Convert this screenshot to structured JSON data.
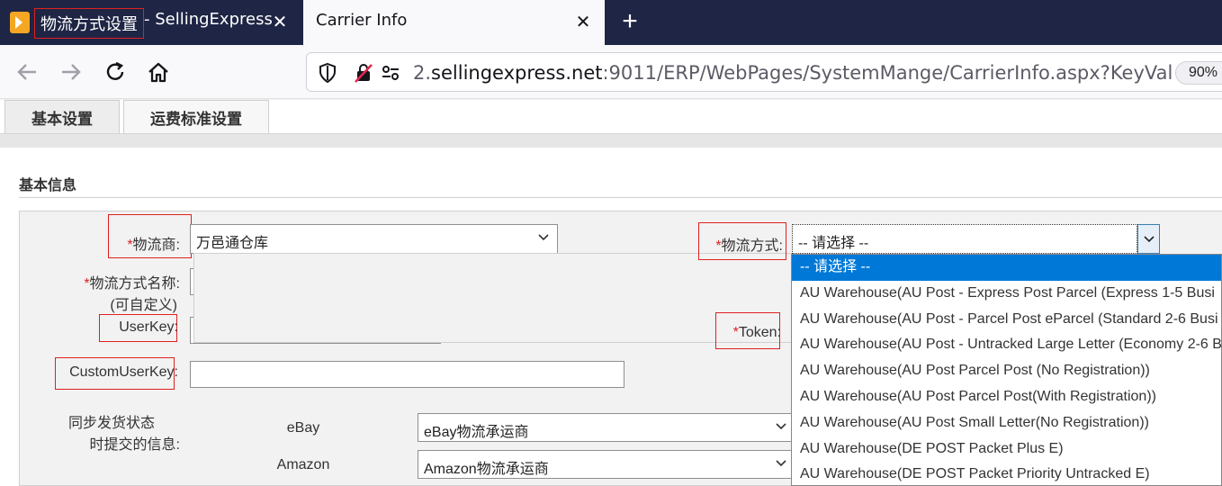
{
  "browser": {
    "tabs": [
      {
        "title_highlight": "物流方式设置",
        "title_rest": "- SellingExpress",
        "active": false
      },
      {
        "title": "Carrier Info",
        "active": true
      }
    ],
    "url_prefix": "2.",
    "url_host": "sellingexpress.net",
    "url_rest": ":9011/ERP/WebPages/SystemMange/CarrierInfo.aspx?KeyVal",
    "zoom": "90%"
  },
  "page_tabs": [
    "基本设置",
    "运费标准设置"
  ],
  "section_title": "基本信息",
  "form": {
    "carrier_label": "物流商:",
    "carrier_value": "万邑通仓库",
    "method_name_label": "物流方式名称:",
    "method_name_hint": "(可自定义)",
    "userkey_label": "UserKey:",
    "customuserkey_label": "CustomUserKey:",
    "shipping_method_label": "物流方式:",
    "shipping_method_value": "-- 请选择 --",
    "token_label": "Token:",
    "required_mark": "*",
    "sync_label_line1": "同步发货状态",
    "sync_label_line2": "时提交的信息:",
    "ebay_label": "eBay",
    "ebay_value": "eBay物流承运商",
    "amazon_label": "Amazon",
    "amazon_value": "Amazon物流承运商"
  },
  "dropdown_options": [
    "-- 请选择 --",
    "AU Warehouse(AU Post - Express Post Parcel (Express 1-5 Busi",
    "AU Warehouse(AU Post - Parcel Post eParcel (Standard 2-6 Busi",
    "AU Warehouse(AU Post - Untracked Large Letter (Economy 2-6 B",
    "AU Warehouse(AU Post Parcel Post (No Registration))",
    "AU Warehouse(AU Post Parcel Post(With Registration))",
    "AU Warehouse(AU Post Small Letter(No Registration))",
    "AU Warehouse(DE POST Packet Plus E)",
    "AU Warehouse(DE POST Packet Priority Untracked E)"
  ],
  "colors": {
    "highlight_red": "#e02020",
    "selected_blue": "#0078d7",
    "tabbar": "#1f2545"
  }
}
